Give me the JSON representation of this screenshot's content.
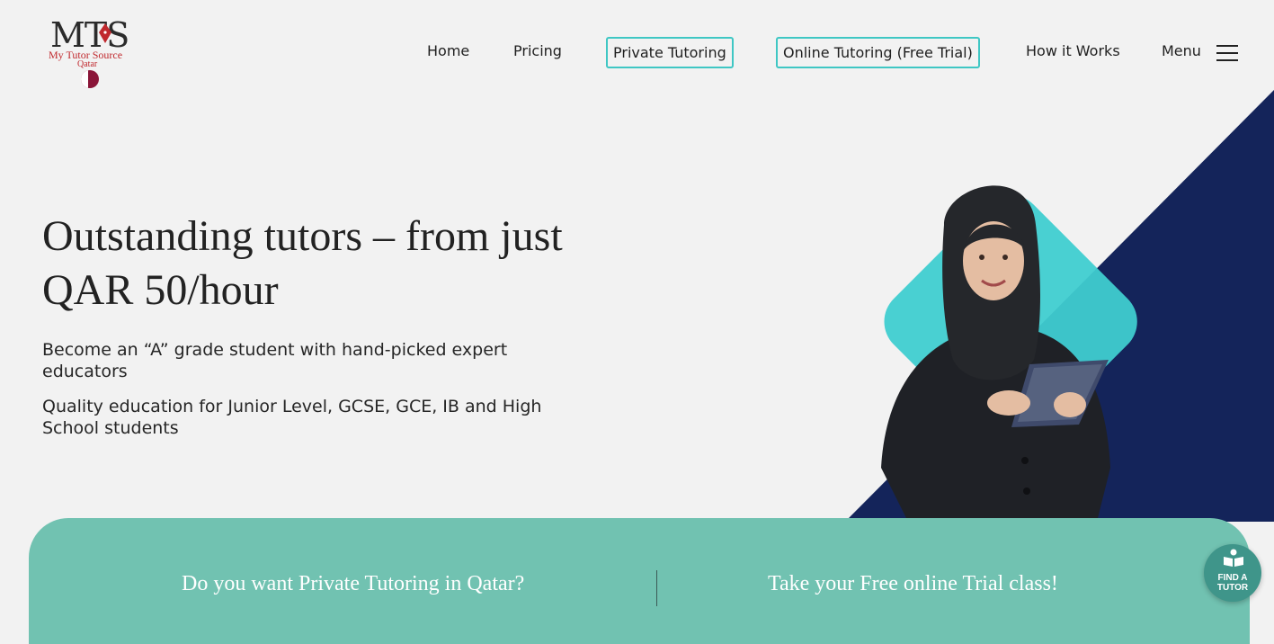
{
  "logo": {
    "mark": "MTS",
    "name": "My Tutor Source",
    "region": "Qatar"
  },
  "nav": {
    "items": [
      {
        "label": "Home"
      },
      {
        "label": "Pricing"
      },
      {
        "label": "Private Tutoring"
      },
      {
        "label": "Online Tutoring (Free Trial)"
      },
      {
        "label": "How it Works"
      }
    ],
    "menu_label": "Menu",
    "menu_icon": "hamburger-icon"
  },
  "hero": {
    "title": "Outstanding tutors – from just QAR 50/hour",
    "subtitle_1": "Become an “A” grade student with hand-picked expert educators",
    "subtitle_2": "Quality education for Junior Level, GCSE, GCE, IB and High School students"
  },
  "band": {
    "left_text": "Do you want Private Tutoring in Qatar?",
    "right_text": "Take your Free online Trial class!"
  },
  "find_tutor": {
    "label": "FIND A TUTOR",
    "icon": "book-reader-icon"
  },
  "colors": {
    "background": "#f2f2f2",
    "accent_teal": "#3fc7c4",
    "navy": "#14245a",
    "band_green": "#71c2b1",
    "logo_red": "#c0282d"
  }
}
